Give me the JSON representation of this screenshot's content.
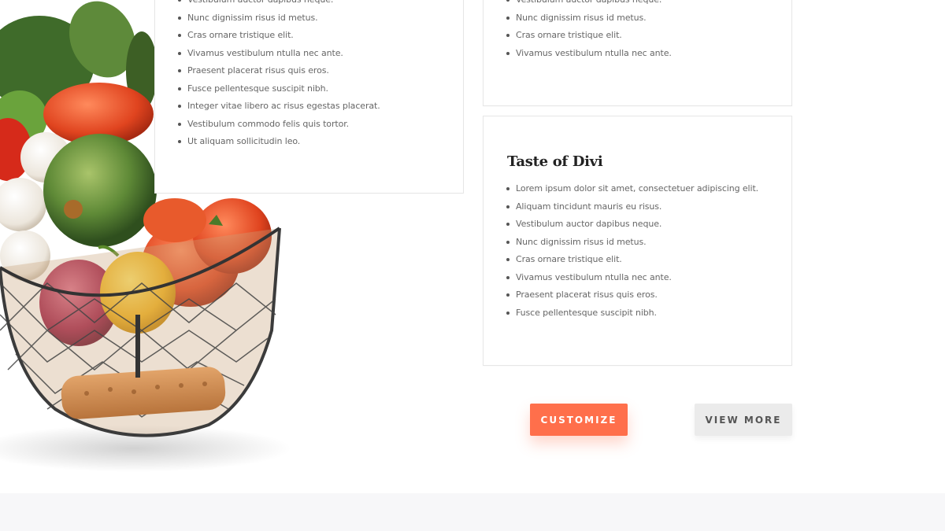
{
  "card_left": {
    "items": [
      "Vestibulum auctor dapibus neque.",
      "Nunc dignissim risus id metus.",
      "Cras ornare tristique elit.",
      "Vivamus vestibulum ntulla nec ante.",
      "Praesent placerat risus quis eros.",
      "Fusce pellentesque suscipit nibh.",
      "Integer vitae libero ac risus egestas placerat.",
      "Vestibulum commodo felis quis tortor.",
      "Ut aliquam sollicitudin leo."
    ]
  },
  "card_right_top": {
    "items": [
      "Vestibulum auctor dapibus neque.",
      "Nunc dignissim risus id metus.",
      "Cras ornare tristique elit.",
      "Vivamus vestibulum ntulla nec ante."
    ]
  },
  "card_right_bottom": {
    "title": "Taste of Divi",
    "items": [
      "Lorem ipsum dolor sit amet, consectetuer adipiscing elit.",
      "Aliquam tincidunt mauris eu risus.",
      "Vestibulum auctor dapibus neque.",
      "Nunc dignissim risus id metus.",
      "Cras ornare tristique elit.",
      "Vivamus vestibulum ntulla nec ante.",
      "Praesent placerat risus quis eros.",
      "Fusce pellentesque suscipit nibh."
    ]
  },
  "buttons": {
    "customize": "Customize",
    "view_more": "View More"
  },
  "colors": {
    "accent": "#ff6f4b",
    "secondary_button": "#ebebeb",
    "footer_band": "#f7f7f9"
  }
}
